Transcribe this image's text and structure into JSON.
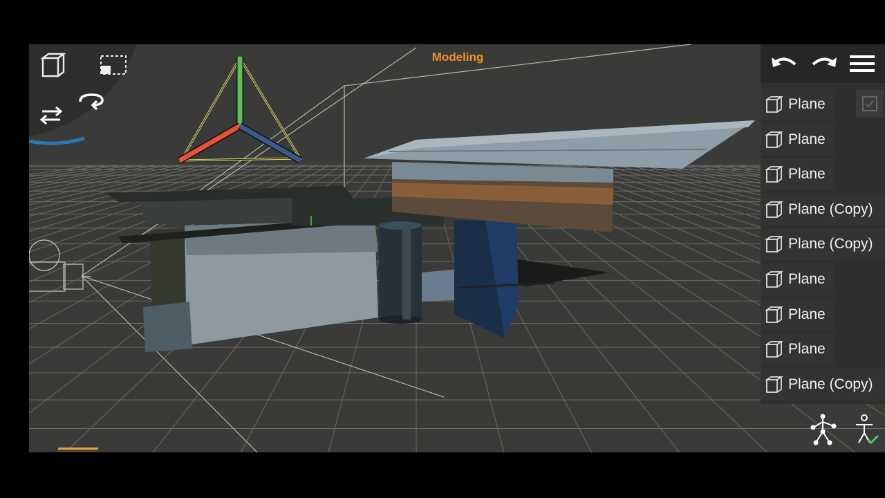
{
  "viewport": {
    "mode_title": "Modeling",
    "colors": {
      "background": "#3a3a38",
      "grid": "#6a6a66",
      "accent": "#f0922a",
      "axis_x": "#e8503a",
      "axis_y": "#5fbf5a",
      "axis_z": "#3a5a8a",
      "gizmo_outline": "#e8e06a"
    }
  },
  "view_dial": {
    "buttons": [
      {
        "name": "perspective-cube-icon"
      },
      {
        "name": "frame-selection-icon"
      },
      {
        "name": "flip-view-icon"
      },
      {
        "name": "orbit-rotate-icon"
      }
    ]
  },
  "top_bar": {
    "icons": [
      "undo-icon",
      "redo-icon",
      "menu-icon"
    ]
  },
  "object_list": {
    "items": [
      {
        "label": "Plane"
      },
      {
        "label": "Plane"
      },
      {
        "label": "Plane"
      },
      {
        "label": "Plane (Copy)"
      },
      {
        "label": "Plane (Copy)"
      },
      {
        "label": "Plane"
      },
      {
        "label": "Plane"
      },
      {
        "label": "Plane"
      },
      {
        "label": "Plane (Copy)"
      }
    ],
    "icon": "object-cube-icon"
  },
  "selection_modes": {
    "items": [
      {
        "name": "object-mode-icon",
        "active": true
      },
      {
        "name": "vertex-mode-icon",
        "active": false
      },
      {
        "name": "edge-mode-icon",
        "active": false
      },
      {
        "name": "face-mode-icon",
        "active": false
      }
    ]
  },
  "bottom_tools": {
    "icons": [
      "skeleton-rig-icon",
      "pose-character-icon"
    ]
  }
}
